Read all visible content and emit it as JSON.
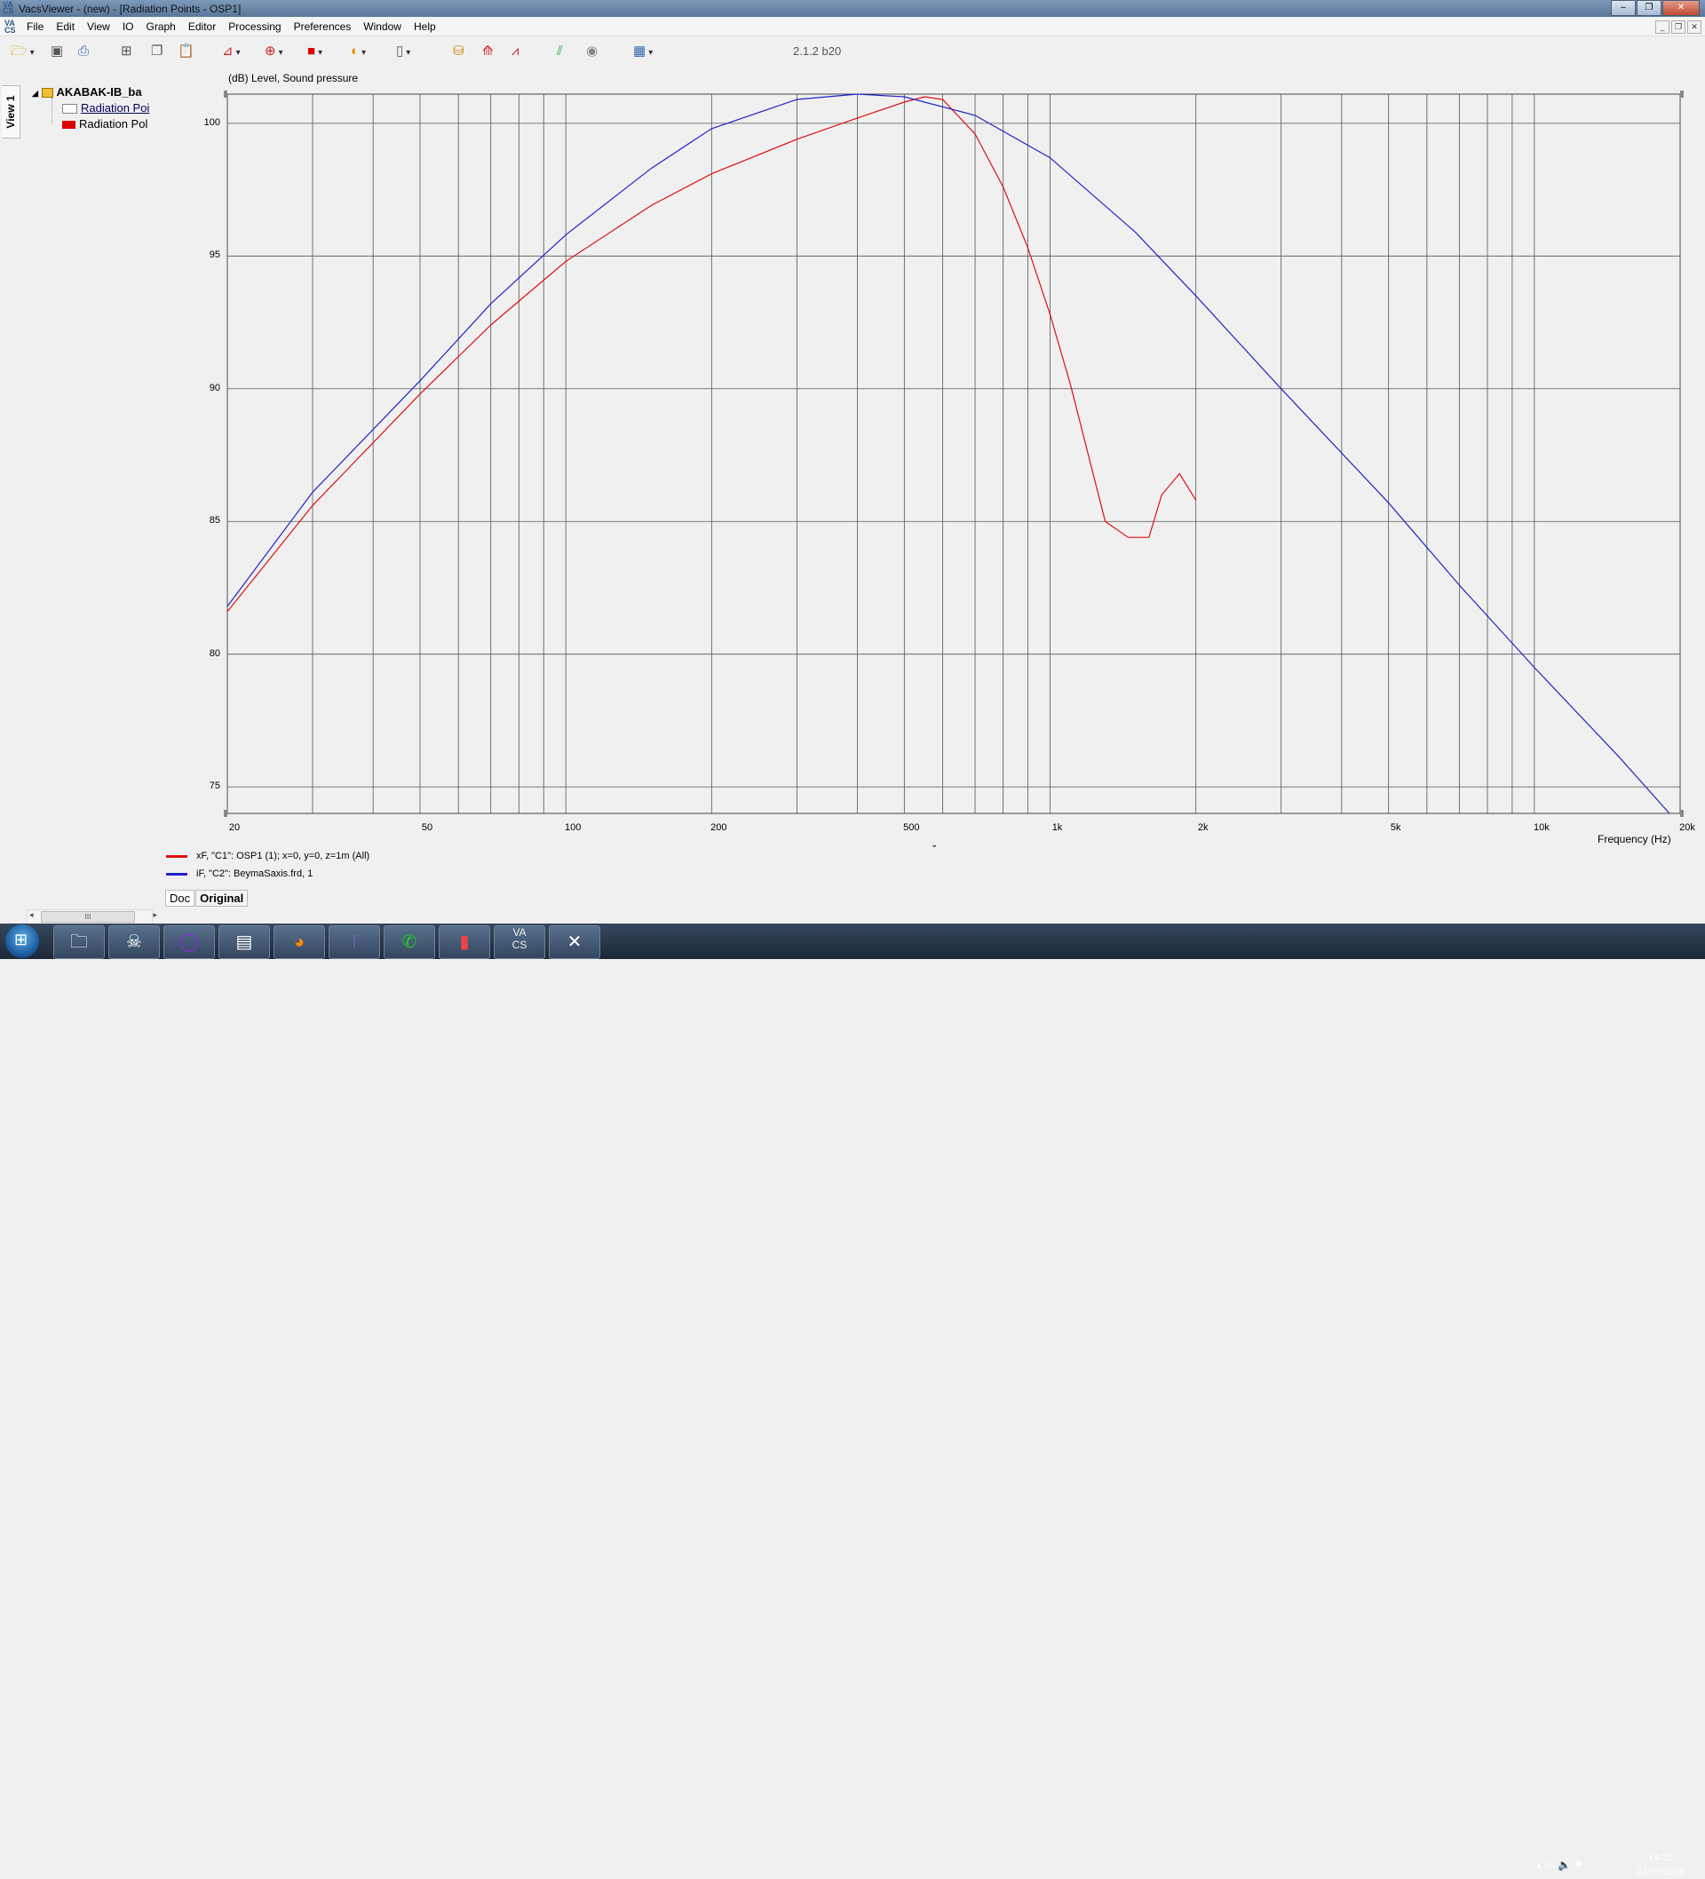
{
  "window": {
    "title": "VacsViewer - (new) - [Radiation Points - OSP1]",
    "minimize": "–",
    "maximize": "❐",
    "close": "✕"
  },
  "menu": {
    "items": [
      "File",
      "Edit",
      "View",
      "IO",
      "Graph",
      "Editor",
      "Processing",
      "Preferences",
      "Window",
      "Help"
    ]
  },
  "toolbar": {
    "version": "2.1.2 b20",
    "icons": [
      "open-folder-icon",
      "save-icon",
      "print-icon",
      "tree-icon",
      "copy-icon",
      "paste-icon",
      "graph-type-icon",
      "polar-icon",
      "color-fill-icon",
      "color-map-icon",
      "page-icon",
      "import-icon",
      "freq-graph-icon",
      "multi-graph-icon",
      "sweep-icon",
      "srp-icon",
      "table-icon"
    ]
  },
  "sidebar": {
    "tab_label": "View 1",
    "root": "AKABAK-IB_ba",
    "children": [
      "Radiation Poi",
      "Radiation Pol"
    ]
  },
  "chart_data": {
    "type": "line",
    "ylabel": "(dB)  Level, Sound pressure",
    "xlabel": "Frequency  (Hz)",
    "xscale": "log",
    "xlim": [
      20,
      20000
    ],
    "ylim": [
      74,
      101.1
    ],
    "x_ticks": [
      {
        "value": 20,
        "label": "20"
      },
      {
        "value": 50,
        "label": "50"
      },
      {
        "value": 100,
        "label": "100"
      },
      {
        "value": 200,
        "label": "200"
      },
      {
        "value": 500,
        "label": "500"
      },
      {
        "value": 1000,
        "label": "1k"
      },
      {
        "value": 2000,
        "label": "2k"
      },
      {
        "value": 5000,
        "label": "5k"
      },
      {
        "value": 10000,
        "label": "10k"
      },
      {
        "value": 20000,
        "label": "20k"
      }
    ],
    "y_ticks": [
      75,
      80,
      85,
      90,
      95,
      100
    ],
    "grid": true,
    "series": [
      {
        "name": "xF, \"C1\": OSP1 (1); x=0, y=0, z=1m  (All)",
        "color": "#dd1111",
        "x": [
          20,
          30,
          50,
          70,
          100,
          150,
          200,
          300,
          400,
          500,
          550,
          600,
          700,
          800,
          900,
          1000,
          1100,
          1300,
          1450,
          1600,
          1700,
          1850,
          2000
        ],
        "y": [
          81.6,
          85.6,
          89.8,
          92.4,
          94.8,
          96.9,
          98.1,
          99.4,
          100.2,
          100.8,
          101.0,
          100.9,
          99.6,
          97.6,
          95.3,
          92.8,
          90.2,
          85.0,
          84.4,
          84.4,
          86.0,
          86.8,
          85.8
        ]
      },
      {
        "name": "iF, \"C2\": BeymaSaxis.frd, 1",
        "color": "#2222cc",
        "x": [
          20,
          30,
          50,
          70,
          100,
          150,
          200,
          300,
          400,
          500,
          700,
          1000,
          1500,
          2000,
          3000,
          5000,
          7000,
          10000,
          15000,
          19000
        ],
        "y": [
          81.8,
          86.1,
          90.3,
          93.2,
          95.8,
          98.3,
          99.8,
          100.9,
          101.1,
          101.0,
          100.3,
          98.7,
          95.9,
          93.5,
          90.0,
          85.7,
          82.6,
          79.5,
          76.1,
          74.0
        ]
      }
    ]
  },
  "bottom_tabs": [
    "Doc",
    "Original"
  ],
  "scrollbar": {
    "thumb": "III",
    "left": "◂",
    "right": "▸"
  },
  "taskbar": {
    "apps": [
      "explorer",
      "alien",
      "circle",
      "excel",
      "firefox",
      "teams",
      "whatsapp",
      "usb",
      "vacs",
      "xapp"
    ],
    "clock_time": "14:32",
    "clock_date": "02/09/2020"
  }
}
